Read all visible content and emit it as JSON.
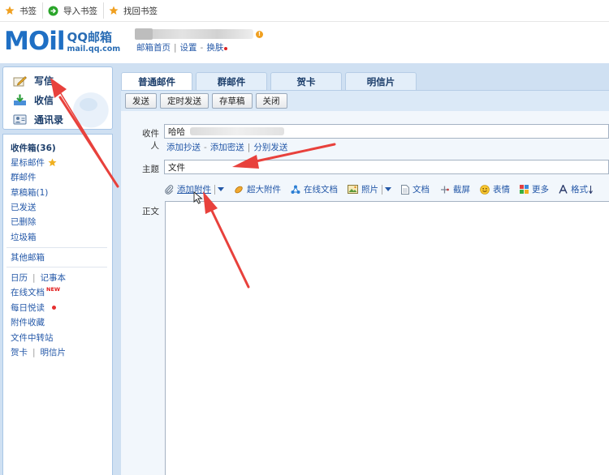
{
  "bookmarks": [
    "书签",
    "导入书签",
    "找回书签"
  ],
  "logo": {
    "brand": "MOil",
    "product": "QQ邮箱",
    "domain": "mail.qq.com"
  },
  "header": {
    "links": [
      "邮箱首页",
      "设置",
      "换肤"
    ],
    "alert_badge": "!"
  },
  "sidebar": {
    "compose": "写信",
    "inbox": "收信",
    "contacts": "通讯录",
    "folders": [
      "收件箱(36)",
      "星标邮件",
      "群邮件",
      "草稿箱(1)",
      "已发送",
      "已删除",
      "垃圾箱"
    ],
    "other": "其他邮箱",
    "tools": {
      "calendar": "日历",
      "notepad": "记事本",
      "online_docs": "在线文档",
      "new_tag": "NEW",
      "daily": "每日悦读",
      "attachments": "附件收藏",
      "transfer": "文件中转站",
      "card": "贺卡",
      "postcard": "明信片"
    }
  },
  "tabs": [
    "普通邮件",
    "群邮件",
    "贺卡",
    "明信片"
  ],
  "toolbar": [
    "发送",
    "定时发送",
    "存草稿",
    "关闭"
  ],
  "compose": {
    "to_label": "收件人",
    "to_value": "哈哈",
    "cc_links": [
      "添加抄送",
      "添加密送",
      "分别发送"
    ],
    "subject_label": "主题",
    "subject_value": "文件",
    "body_label": "正文",
    "attach_tools": [
      "添加附件",
      "超大附件",
      "在线文档",
      "照片",
      "文档",
      "截屏",
      "表情",
      "更多",
      "格式"
    ]
  },
  "colors": {
    "accent": "#1f6fc4",
    "link": "#2458a8",
    "band": "#cfe0f2",
    "annotation_arrow": "#e8413c"
  }
}
